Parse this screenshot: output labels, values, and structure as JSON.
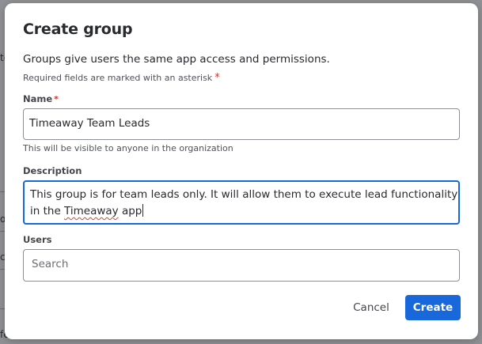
{
  "background": {
    "fragments": [
      "te",
      "o",
      "c",
      "fe"
    ]
  },
  "dialog": {
    "title": "Create group",
    "description": "Groups give users the same app access and permissions.",
    "required_note": "Required fields are marked with an asterisk",
    "required_marker": "*",
    "name": {
      "label": "Name",
      "value": "Timeaway Team Leads",
      "helper": "This will be visible to anyone in the organization"
    },
    "description_field": {
      "label": "Description",
      "value_line1": "This group is for team leads only. It will allow them to execute lead functionality",
      "value_line2_prefix": "in the ",
      "value_line2_misspelled": "Timeaway",
      "value_line2_suffix": " app"
    },
    "users": {
      "label": "Users",
      "placeholder": "Search"
    },
    "cancel_label": "Cancel",
    "create_label": "Create"
  },
  "colors": {
    "accent": "#1868db",
    "required": "#c9372c",
    "overlay": "#8f9194",
    "text": "#292a2e"
  }
}
